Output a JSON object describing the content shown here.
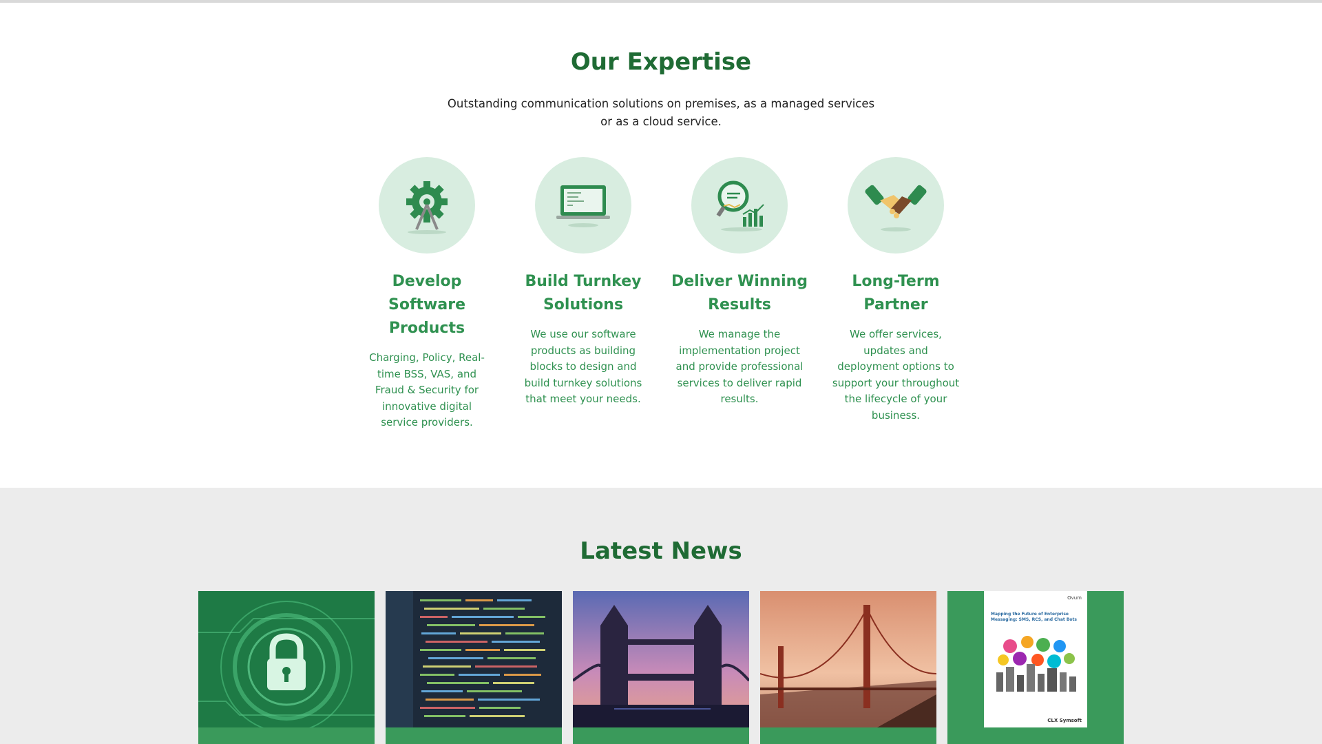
{
  "expertise": {
    "title": "Our Expertise",
    "subtitle": "Outstanding communication solutions on premises, as a managed services or as a cloud service.",
    "cards": [
      {
        "title": "Develop Software Products",
        "text": "Charging, Policy, Real-time BSS, VAS, and Fraud & Security for innovative digital service providers.",
        "icon": "gear-compass-icon"
      },
      {
        "title": "Build Turnkey Solutions",
        "text": "We use our software products as building blocks to design and build turnkey solutions that meet your needs.",
        "icon": "laptop-code-icon"
      },
      {
        "title": "Deliver Winning Results",
        "text": "We manage the implementation project and provide professional services to deliver rapid results.",
        "icon": "magnifier-chart-icon"
      },
      {
        "title": "Long-Term Partner",
        "text": "We offer services, updates and deployment options to support your throughout the lifecycle of your business.",
        "icon": "handshake-icon"
      }
    ]
  },
  "news": {
    "title": "Latest News",
    "items": [
      {
        "image": "security-lock-image"
      },
      {
        "image": "source-code-image"
      },
      {
        "image": "tower-bridge-image"
      },
      {
        "image": "golden-gate-bridge-image"
      },
      {
        "image": "ovum-report-cover-image",
        "cover_brand": "Ovum",
        "cover_title": "Mapping the Future of Enterprise Messaging: SMS, RCS, and Chat Bots",
        "cover_logos": "CLX  Symsoft"
      }
    ]
  },
  "colors": {
    "heading_green": "#1f6b34",
    "accent_green": "#2f9150",
    "icon_bg": "#d8ede0",
    "news_bg": "#ececec",
    "card_green": "#3a9a5b"
  }
}
